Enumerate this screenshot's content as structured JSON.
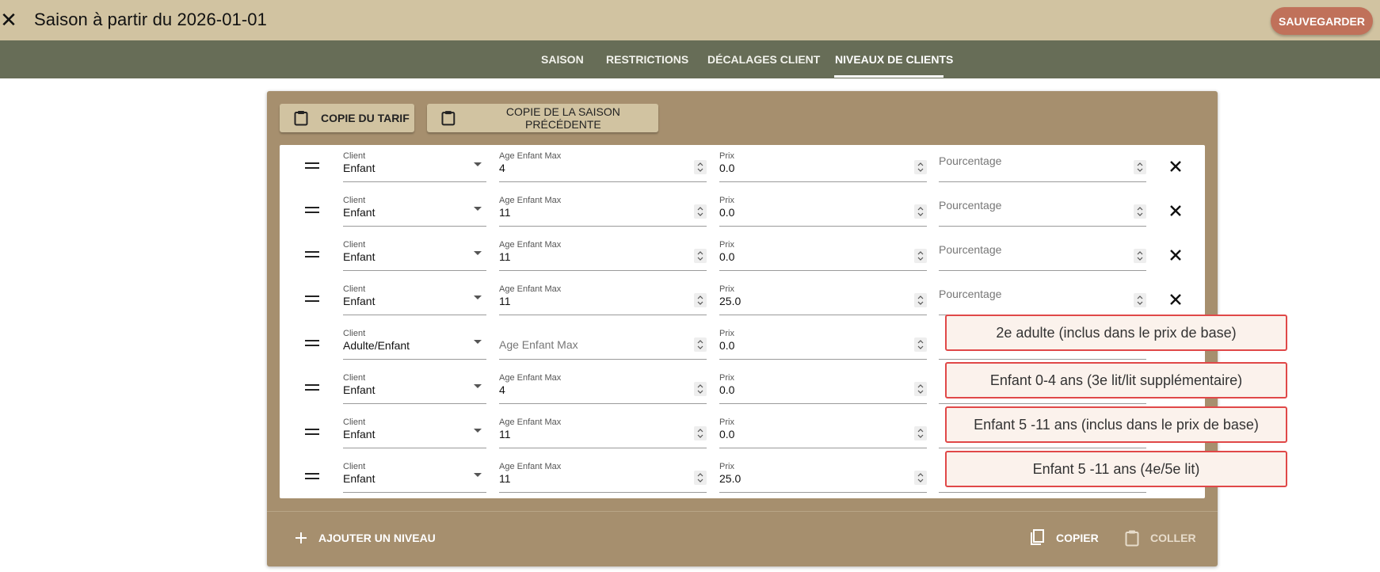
{
  "header": {
    "title": "Saison à partir du 2026-01-01",
    "close_icon": "close-icon",
    "save_label": "SAUVEGARDER"
  },
  "tabs": [
    {
      "label": "SAISON",
      "active": false
    },
    {
      "label": "RESTRICTIONS",
      "active": false
    },
    {
      "label": "DÉCALAGES CLIENT",
      "active": false
    },
    {
      "label": "NIVEAUX DE CLIENTS",
      "active": true
    }
  ],
  "toolbar": {
    "copy_rate_label": "COPIE DU TARIF",
    "copy_prev_season_label": "COPIE DE LA SAISON PRÉCÉDENTE",
    "icon": "clipboard-icon"
  },
  "field_labels": {
    "client": "Client",
    "age": "Age Enfant Max",
    "prix": "Prix",
    "pourcentage": "Pourcentage"
  },
  "levels": [
    {
      "client": "Enfant",
      "age": "4",
      "prix": "0.0",
      "pourcentage": ""
    },
    {
      "client": "Enfant",
      "age": "11",
      "prix": "0.0",
      "pourcentage": ""
    },
    {
      "client": "Enfant",
      "age": "11",
      "prix": "0.0",
      "pourcentage": ""
    },
    {
      "client": "Enfant",
      "age": "11",
      "prix": "25.0",
      "pourcentage": ""
    },
    {
      "client": "Adulte/Enfant",
      "age": "",
      "prix": "0.0",
      "pourcentage": ""
    },
    {
      "client": "Enfant",
      "age": "4",
      "prix": "0.0",
      "pourcentage": ""
    },
    {
      "client": "Enfant",
      "age": "11",
      "prix": "0.0",
      "pourcentage": ""
    },
    {
      "client": "Enfant",
      "age": "11",
      "prix": "25.0",
      "pourcentage": ""
    }
  ],
  "footer": {
    "add_level_label": "AJOUTER UN NIVEAU",
    "copy_label": "COPIER",
    "paste_label": "COLLER"
  },
  "annotations": [
    "2e adulte (inclus dans le prix de base)",
    "Enfant 0-4 ans (3e lit/lit supplémentaire)",
    "Enfant 5 -11 ans (inclus dans le prix de base)",
    "Enfant 5 -11 ans (4e/5e lit)"
  ],
  "colors": {
    "header_bg": "#d1c3a1",
    "tabbar_bg": "#676d57",
    "panel_bg": "#a68f6e",
    "save_button": "#c0715a",
    "annotation_border": "#e04848"
  }
}
